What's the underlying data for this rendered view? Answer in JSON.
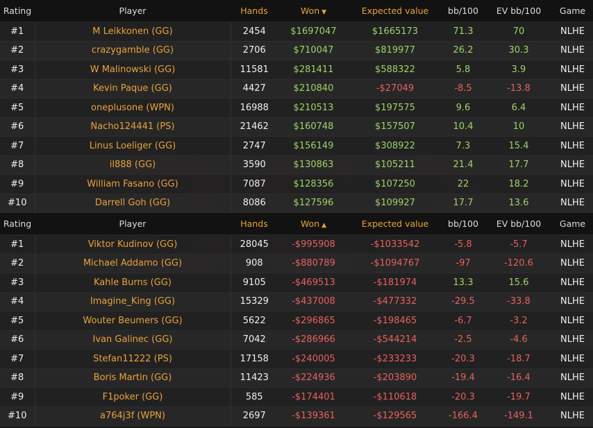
{
  "colors": {
    "orange": "#e9a23b",
    "green": "#9fd36a",
    "red": "#e8615e",
    "header_bg": "#121212",
    "row_bg": "#242424"
  },
  "top_table": {
    "headers": {
      "rating": "Rating",
      "player": "Player",
      "hands": "Hands",
      "won": "Won",
      "ev": "Expected value",
      "bb": "bb/100",
      "evbb": "EV bb/100",
      "game": "Game"
    },
    "sort_icon": "caret-down-icon",
    "rows": [
      {
        "rating": "#1",
        "player": "M Leikkonen (GG)",
        "hands": "2454",
        "won": "$1697047",
        "ev": "$1665173",
        "bb": "71.3",
        "evbb": "70",
        "game": "NLHE"
      },
      {
        "rating": "#2",
        "player": "crazygamble (GG)",
        "hands": "2706",
        "won": "$710047",
        "ev": "$819977",
        "bb": "26.2",
        "evbb": "30.3",
        "game": "NLHE"
      },
      {
        "rating": "#3",
        "player": "W Malinowski (GG)",
        "hands": "11581",
        "won": "$281411",
        "ev": "$588322",
        "bb": "5.8",
        "evbb": "3.9",
        "game": "NLHE"
      },
      {
        "rating": "#4",
        "player": "Kevin Paque (GG)",
        "hands": "4427",
        "won": "$210840",
        "ev": "-$27049",
        "bb": "-8.5",
        "evbb": "-13.8",
        "game": "NLHE"
      },
      {
        "rating": "#5",
        "player": "oneplusone (WPN)",
        "hands": "16988",
        "won": "$210513",
        "ev": "$197575",
        "bb": "9.6",
        "evbb": "6.4",
        "game": "NLHE"
      },
      {
        "rating": "#6",
        "player": "Nacho124441 (PS)",
        "hands": "21462",
        "won": "$160748",
        "ev": "$157507",
        "bb": "10.4",
        "evbb": "10",
        "game": "NLHE"
      },
      {
        "rating": "#7",
        "player": "Linus Loeliger (GG)",
        "hands": "2747",
        "won": "$156149",
        "ev": "$308922",
        "bb": "7.3",
        "evbb": "15.4",
        "game": "NLHE"
      },
      {
        "rating": "#8",
        "player": "il888 (GG)",
        "hands": "3590",
        "won": "$130863",
        "ev": "$105211",
        "bb": "21.4",
        "evbb": "17.7",
        "game": "NLHE"
      },
      {
        "rating": "#9",
        "player": "William Fasano (GG)",
        "hands": "7087",
        "won": "$128356",
        "ev": "$107250",
        "bb": "22",
        "evbb": "18.2",
        "game": "NLHE"
      },
      {
        "rating": "#10",
        "player": "Darrell Goh (GG)",
        "hands": "8086",
        "won": "$127596",
        "ev": "$109927",
        "bb": "17.7",
        "evbb": "13.6",
        "game": "NLHE"
      }
    ]
  },
  "bottom_table": {
    "headers": {
      "rating": "Rating",
      "player": "Player",
      "hands": "Hands",
      "won": "Won",
      "ev": "Expected value",
      "bb": "bb/100",
      "evbb": "EV bb/100",
      "game": "Game"
    },
    "sort_icon": "caret-up-icon",
    "rows": [
      {
        "rating": "#1",
        "player": "Viktor Kudinov (GG)",
        "hands": "28045",
        "won": "-$995908",
        "ev": "-$1033542",
        "bb": "-5.8",
        "evbb": "-5.7",
        "game": "NLHE"
      },
      {
        "rating": "#2",
        "player": "Michael Addamo (GG)",
        "hands": "908",
        "won": "-$880789",
        "ev": "-$1094767",
        "bb": "-97",
        "evbb": "-120.6",
        "game": "NLHE"
      },
      {
        "rating": "#3",
        "player": "Kahle Burns (GG)",
        "hands": "9105",
        "won": "-$469513",
        "ev": "-$181974",
        "bb": "13.3",
        "evbb": "15.6",
        "game": "NLHE"
      },
      {
        "rating": "#4",
        "player": "Imagine_King (GG)",
        "hands": "15329",
        "won": "-$437008",
        "ev": "-$477332",
        "bb": "-29.5",
        "evbb": "-33.8",
        "game": "NLHE"
      },
      {
        "rating": "#5",
        "player": "Wouter Beumers (GG)",
        "hands": "5622",
        "won": "-$296865",
        "ev": "-$198465",
        "bb": "-6.7",
        "evbb": "-3.2",
        "game": "NLHE"
      },
      {
        "rating": "#6",
        "player": "Ivan Galinec (GG)",
        "hands": "7042",
        "won": "-$286966",
        "ev": "-$544214",
        "bb": "-2.5",
        "evbb": "-4.6",
        "game": "NLHE"
      },
      {
        "rating": "#7",
        "player": "Stefan11222 (PS)",
        "hands": "17158",
        "won": "-$240005",
        "ev": "-$233233",
        "bb": "-20.3",
        "evbb": "-18.7",
        "game": "NLHE"
      },
      {
        "rating": "#8",
        "player": "Boris Martin (GG)",
        "hands": "11423",
        "won": "-$224936",
        "ev": "-$203890",
        "bb": "-19.4",
        "evbb": "-16.4",
        "game": "NLHE"
      },
      {
        "rating": "#9",
        "player": "F1poker (GG)",
        "hands": "585",
        "won": "-$174401",
        "ev": "-$110618",
        "bb": "-20.3",
        "evbb": "-19.7",
        "game": "NLHE"
      },
      {
        "rating": "#10",
        "player": "a764j3f (WPN)",
        "hands": "2697",
        "won": "-$139361",
        "ev": "-$129565",
        "bb": "-166.4",
        "evbb": "-149.1",
        "game": "NLHE"
      }
    ]
  }
}
